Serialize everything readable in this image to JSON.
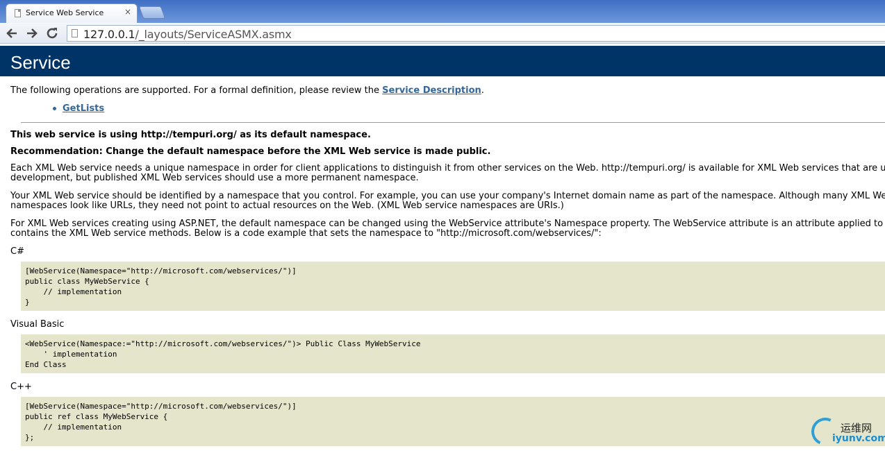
{
  "browser": {
    "tab_title": "Service Web Service",
    "tab_close": "×",
    "url_host": "127.0.0.1",
    "url_path": "/_layouts/ServiceASMX.asmx"
  },
  "page": {
    "heading": "Service",
    "intro_prefix": "The following operations are supported. For a formal definition, please review the ",
    "intro_link": "Service Description",
    "intro_suffix": ".",
    "operations": [
      "GetLists"
    ],
    "namespace_notice": "This web service is using http://tempuri.org/ as its default namespace.",
    "recommendation": "Recommendation: Change the default namespace before the XML Web service is made public.",
    "para1_line1": "Each XML Web service needs a unique namespace in order for client applications to distinguish it from other services on the Web. http://tempuri.org/ is available for XML Web services that are under",
    "para1_line2": "development, but published XML Web services should use a more permanent namespace.",
    "para2_line1": "Your XML Web service should be identified by a namespace that you control. For example, you can use your company's Internet domain name as part of the namespace. Although many XML Web service",
    "para2_line2": "namespaces look like URLs, they need not point to actual resources on the Web. (XML Web service namespaces are URIs.)",
    "para3_line1": "For XML Web services creating using ASP.NET, the default namespace can be changed using the WebService attribute's Namespace property. The WebService attribute is an attribute applied to the class that",
    "para3_line2": "contains the XML Web service methods. Below is a code example that sets the namespace to \"http://microsoft.com/webservices/\":",
    "csharp_label": "C#",
    "csharp_code": "[WebService(Namespace=\"http://microsoft.com/webservices/\")]\npublic class MyWebService {\n    // implementation\n}",
    "vb_label": "Visual Basic",
    "vb_code": "<WebService(Namespace:=\"http://microsoft.com/webservices/\")> Public Class MyWebService\n    ' implementation\nEnd Class",
    "cpp_label": "C++",
    "cpp_code": "[WebService(Namespace=\"http://microsoft.com/webservices/\")]\npublic ref class MyWebService {\n    // implementation\n};"
  },
  "watermark": {
    "cn": "运维网",
    "en": "iyunv.com"
  },
  "colors": {
    "banner": "#003366",
    "link": "#336699",
    "code_bg": "#e5e5cc"
  }
}
